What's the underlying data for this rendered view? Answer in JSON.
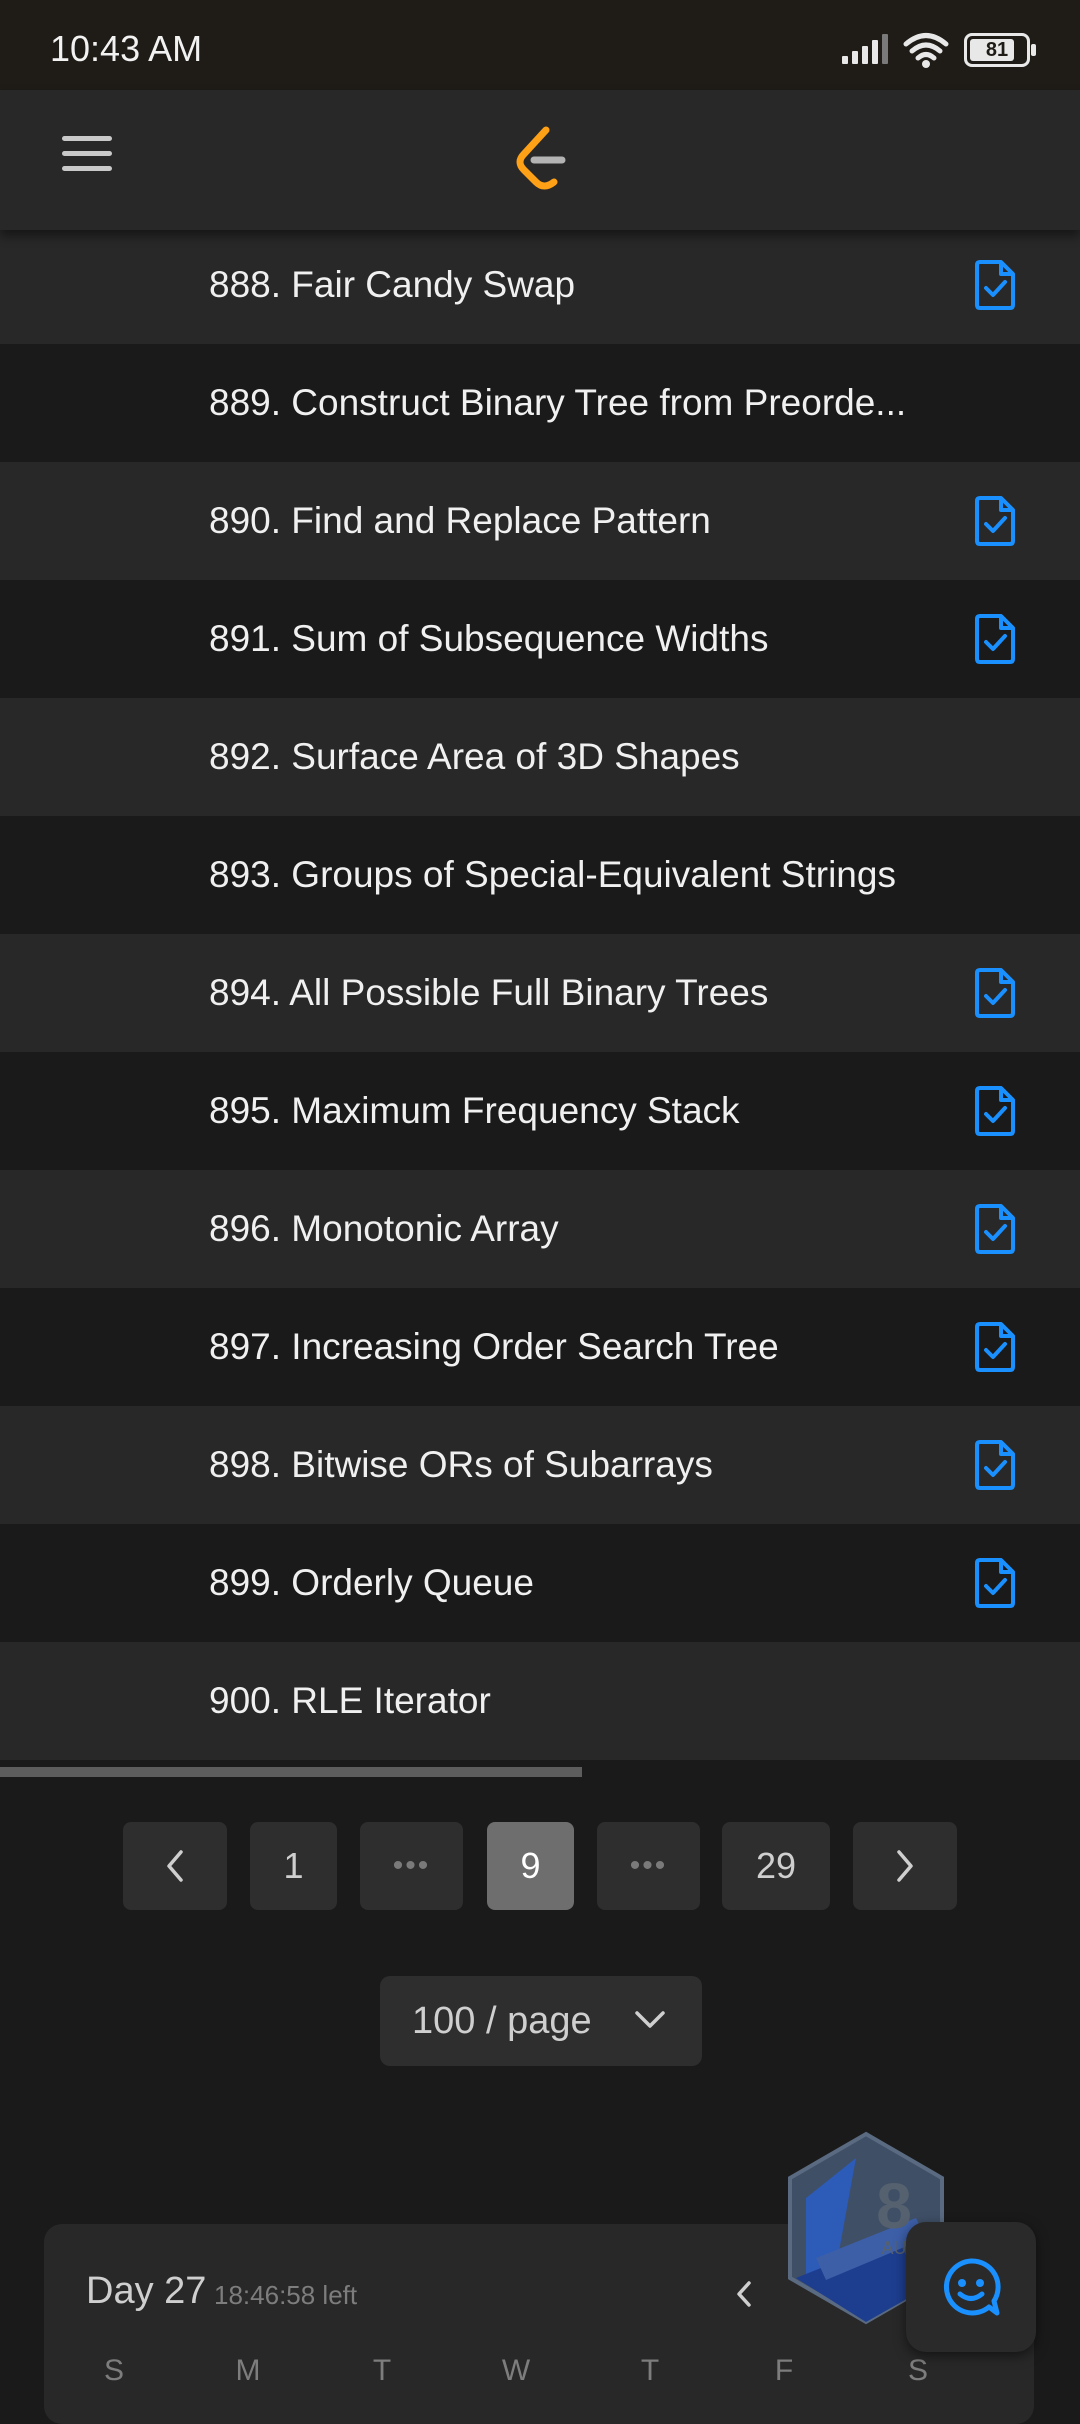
{
  "status_bar": {
    "time": "10:43 AM",
    "battery": "81"
  },
  "problems": [
    {
      "title": "888. Fair Candy Swap",
      "solved": true
    },
    {
      "title": "889. Construct Binary Tree from Preorde...",
      "solved": false
    },
    {
      "title": "890. Find and Replace Pattern",
      "solved": true
    },
    {
      "title": "891. Sum of Subsequence Widths",
      "solved": true
    },
    {
      "title": "892. Surface Area of 3D Shapes",
      "solved": false
    },
    {
      "title": "893. Groups of Special-Equivalent Strings",
      "solved": false
    },
    {
      "title": "894. All Possible Full Binary Trees",
      "solved": true
    },
    {
      "title": "895. Maximum Frequency Stack",
      "solved": true
    },
    {
      "title": "896. Monotonic Array",
      "solved": true
    },
    {
      "title": "897. Increasing Order Search Tree",
      "solved": true
    },
    {
      "title": "898. Bitwise ORs of Subarrays",
      "solved": true
    },
    {
      "title": "899. Orderly Queue",
      "solved": true
    },
    {
      "title": "900. RLE Iterator",
      "solved": false
    }
  ],
  "pagination": {
    "first": "1",
    "ellipsis": "•••",
    "current": "9",
    "last": "29"
  },
  "page_size": {
    "label": "100 / page"
  },
  "calendar": {
    "day": "Day 27",
    "time_left": "18:46:58 left",
    "weekdays": [
      "S",
      "M",
      "T",
      "W",
      "T",
      "F",
      "S"
    ]
  },
  "colors": {
    "accent_blue": "#1a90ff",
    "logo_orange": "#ffa116",
    "background": "#1a1a1a",
    "row_alt": "#282828"
  },
  "icons": {
    "menu": "menu-icon",
    "logo": "leetcode-logo",
    "solved": "solved-check-icon",
    "prev": "chevron-left-icon",
    "next": "chevron-right-icon",
    "dropdown": "chevron-down-icon",
    "feedback": "smiley-chat-icon",
    "badge": "monthly-badge-icon"
  }
}
